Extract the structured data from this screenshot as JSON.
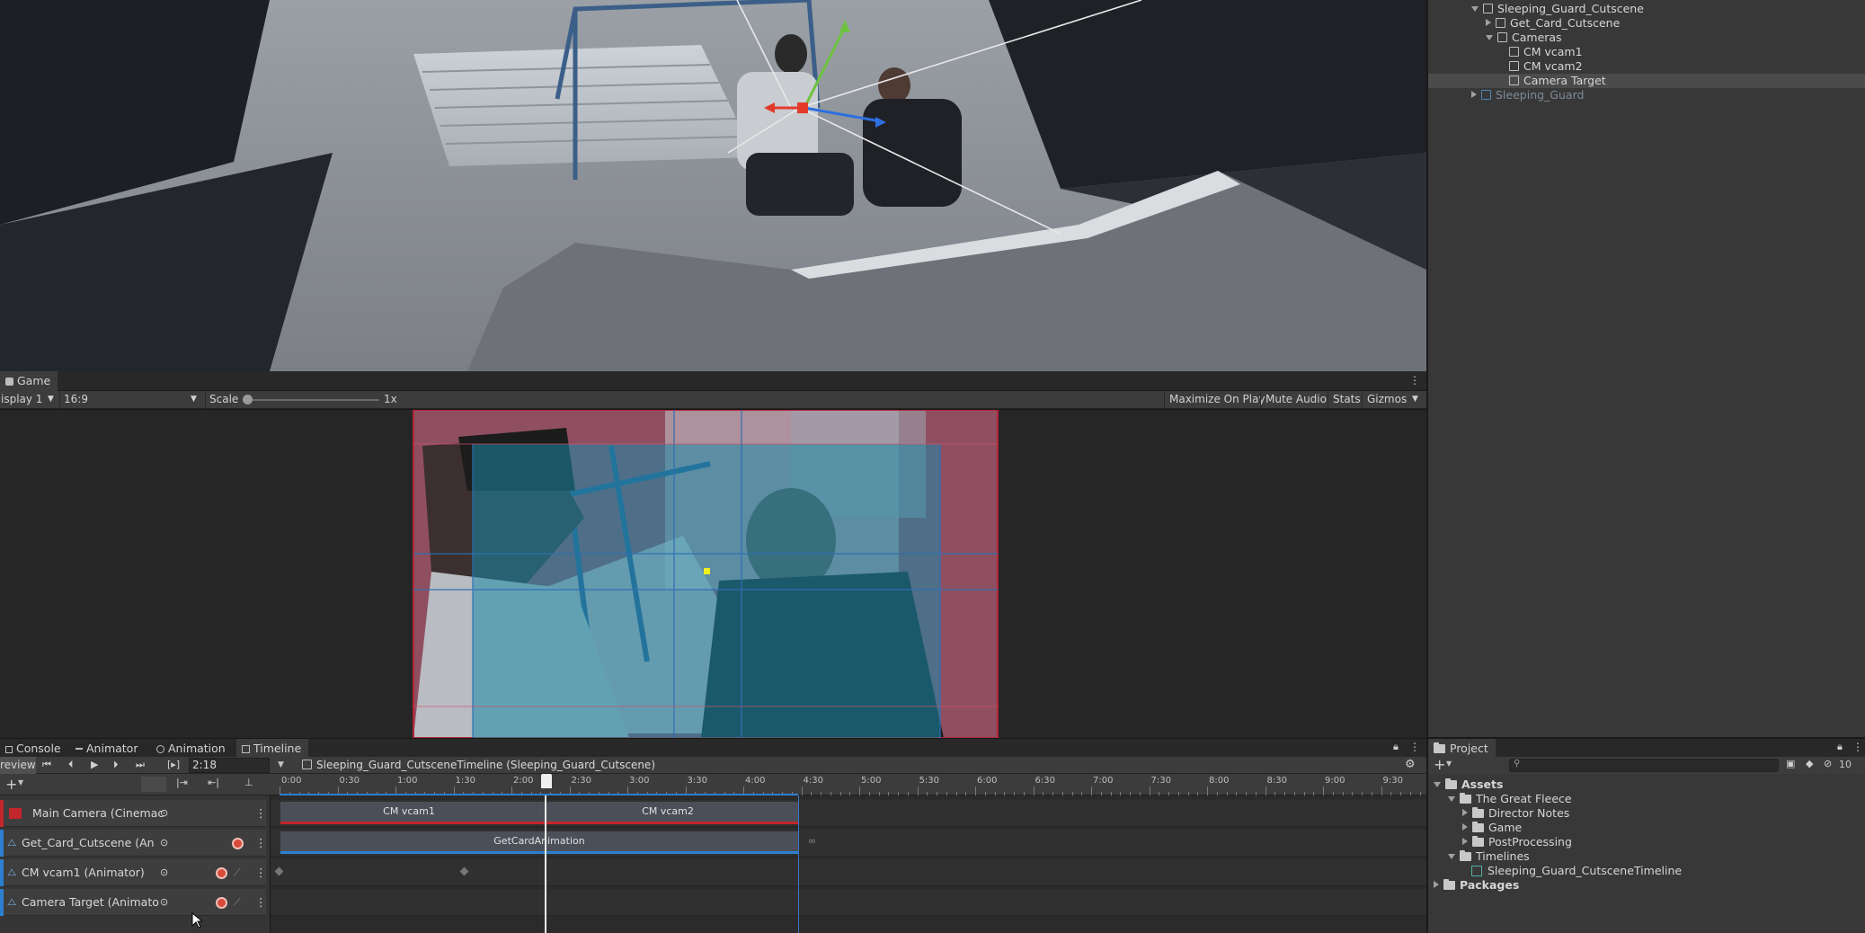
{
  "hierarchy": {
    "items": [
      {
        "label": "Sleeping_Guard_Cutscene",
        "expanded": true
      },
      {
        "label": "Get_Card_Cutscene",
        "expanded": false
      },
      {
        "label": "Cameras",
        "expanded": true
      },
      {
        "label": "CM vcam1"
      },
      {
        "label": "CM vcam2"
      },
      {
        "label": "Camera Target",
        "selected": true
      },
      {
        "label": "Sleeping_Guard",
        "expanded": false,
        "disabled": true
      }
    ]
  },
  "game": {
    "tab_label": "Game",
    "display": "isplay 1",
    "aspect": "16:9",
    "scale_label": "Scale",
    "scale_value": "1x",
    "buttons": [
      "Maximize On Play",
      "Mute Audio",
      "Stats",
      "Gizmos"
    ]
  },
  "bottom_tabs": [
    {
      "label": "Console"
    },
    {
      "label": "Animator"
    },
    {
      "label": "Animation"
    },
    {
      "label": "Timeline",
      "active": true
    }
  ],
  "timeline": {
    "preview_label": "review",
    "current_time": "2:18",
    "asset_path": "Sleeping_Guard_CutsceneTimeline (Sleeping_Guard_Cutscene)",
    "ruler_labels": [
      "0:00",
      "0:30",
      "1:00",
      "1:30",
      "2:00",
      "2:30",
      "3:00",
      "3:30",
      "4:00",
      "4:30",
      "5:00",
      "5:30",
      "6:00",
      "6:30",
      "7:00",
      "7:30",
      "8:00",
      "8:30",
      "9:00",
      "9:30"
    ],
    "tracks": [
      {
        "label": "Main Camera (Cinemac",
        "accent": "#c0262b"
      },
      {
        "label": "Get_Card_Cutscene (An",
        "accent": "#2d7fd1"
      },
      {
        "label": "CM vcam1 (Animator)",
        "accent": "#2d7fd1"
      },
      {
        "label": "Camera Target (Animato",
        "accent": "#2d7fd1"
      }
    ],
    "clips": {
      "vcam1": "CM vcam1",
      "vcam2": "CM vcam2",
      "card_anim": "GetCardAnimation"
    },
    "accent_red": "#c0262b",
    "accent_blue": "#2d7fd1"
  },
  "project": {
    "tab_label": "Project",
    "hidden_count": "10",
    "items": [
      {
        "label": "Assets",
        "bold": true
      },
      {
        "label": "The Great Fleece"
      },
      {
        "label": "Director Notes"
      },
      {
        "label": "Game"
      },
      {
        "label": "PostProcessing"
      },
      {
        "label": "Timelines"
      },
      {
        "label": "Sleeping_Guard_CutsceneTimeline"
      },
      {
        "label": "Packages",
        "bold": true
      }
    ]
  }
}
